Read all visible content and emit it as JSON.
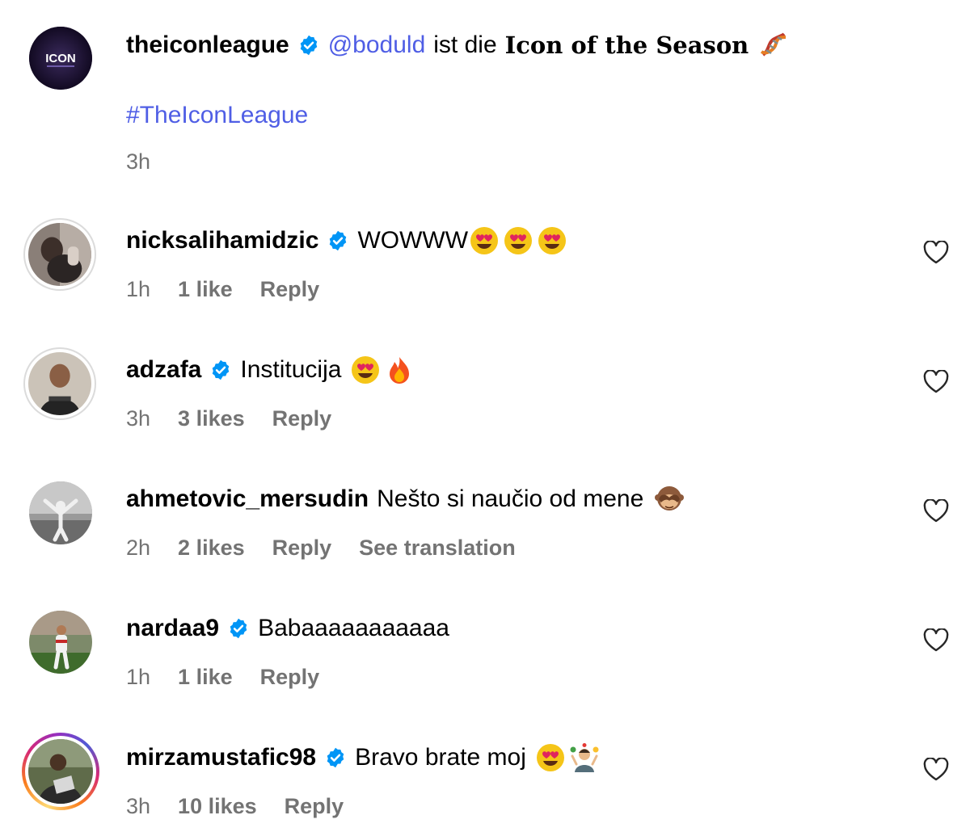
{
  "post": {
    "username": "theiconleague",
    "mention": "@boduld",
    "text_middle": "ist die",
    "text_bold": "Icon of the Season",
    "hashtag": "#TheIconLeague",
    "time": "3h",
    "avatar_text": "ICON"
  },
  "comments": [
    {
      "username": "nicksalihamidzic",
      "text": "WOWWW",
      "time": "1h",
      "likes": "1 like",
      "reply": "Reply",
      "emojis": [
        "heart-eyes",
        "heart-eyes",
        "heart-eyes"
      ]
    },
    {
      "username": "adzafa",
      "text": "Institucija",
      "time": "3h",
      "likes": "3 likes",
      "reply": "Reply",
      "emojis": [
        "heart-eyes",
        "fire"
      ]
    },
    {
      "username": "ahmetovic_mersudin",
      "text": "Nešto si naučio od mene",
      "time": "2h",
      "likes": "2 likes",
      "reply": "Reply",
      "translate": "See translation",
      "emojis": [
        "see-no-evil-monkey"
      ]
    },
    {
      "username": "nardaa9",
      "text": "Babaaaaaaaaaaa",
      "time": "1h",
      "likes": "1 like",
      "reply": "Reply",
      "emojis": []
    },
    {
      "username": "mirzamustafic98",
      "text": "Bravo brate moj",
      "time": "3h",
      "likes": "10 likes",
      "reply": "Reply",
      "emojis": [
        "heart-eyes",
        "juggler"
      ]
    }
  ],
  "colors": {
    "link": "#4f5ee5",
    "verified": "#0095f6",
    "meta": "#737373"
  }
}
